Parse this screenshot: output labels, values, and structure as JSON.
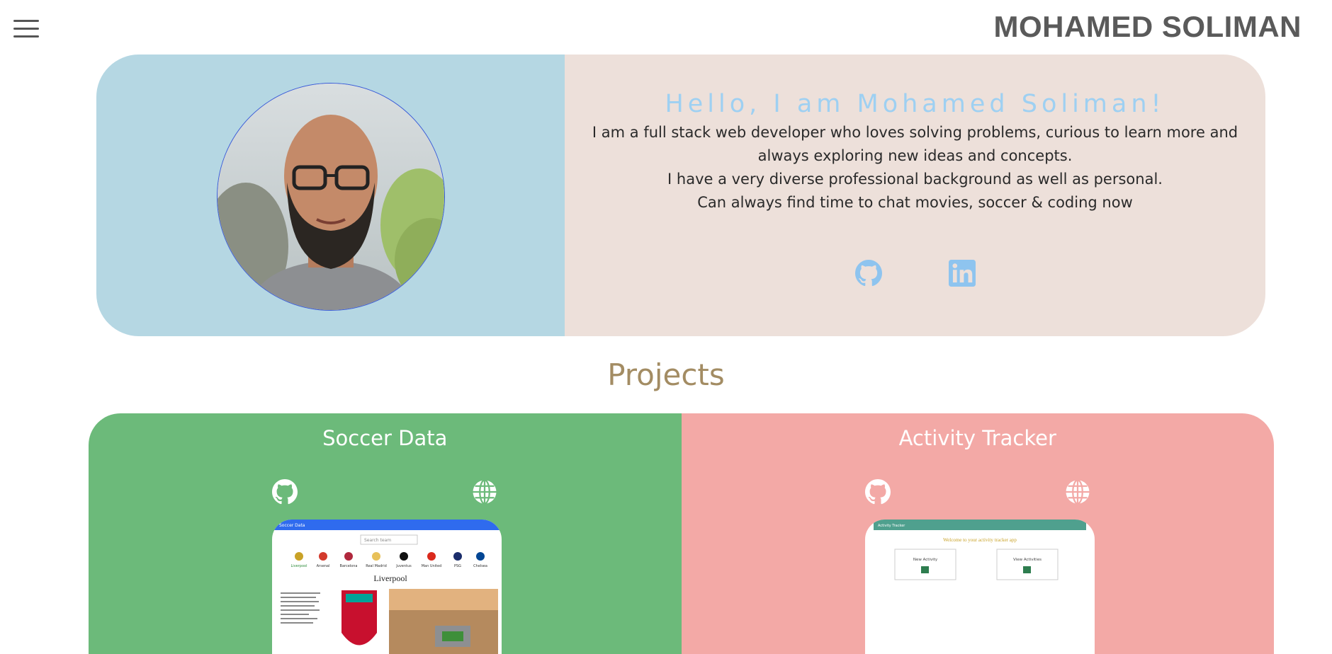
{
  "header": {
    "site_title": "MOHAMED SOLIMAN",
    "menu_icon": "hamburger-menu-icon"
  },
  "hero": {
    "greeting": "Hello, I am Mohamed Soliman!",
    "bio_lines": [
      "I am a full stack web developer who loves solving problems, curious to learn more and always exploring new ideas and concepts.",
      "I have a very diverse professional background as well as personal.",
      "Can always find time to chat movies, soccer & coding now"
    ],
    "links": [
      {
        "icon": "github-icon"
      },
      {
        "icon": "linkedin-icon"
      }
    ]
  },
  "projects": {
    "heading": "Projects",
    "items": [
      {
        "title": "Soccer Data",
        "color": "#6cba7a",
        "links": [
          {
            "icon": "github-icon"
          },
          {
            "icon": "globe-icon"
          }
        ],
        "preview": {
          "app_bar_text": "Soccer Data",
          "search_placeholder": "Search team",
          "teams": [
            "Liverpool",
            "Arsenal",
            "Barcelona",
            "Real Madrid",
            "Juventus",
            "Man United",
            "PSG",
            "Chelsea"
          ],
          "selected_team": "Liverpool"
        }
      },
      {
        "title": "Activity Tracker",
        "color": "#f3a9a6",
        "links": [
          {
            "icon": "github-icon"
          },
          {
            "icon": "globe-icon"
          }
        ],
        "preview": {
          "app_bar_text": "Activity Tracker",
          "welcome": "Welcome to your activity tracker app",
          "cards": [
            "New Activity",
            "View Activities"
          ]
        }
      }
    ]
  },
  "colors": {
    "hero_left_bg": "#b5d7e3",
    "hero_right_bg": "#ede0da",
    "greeting_text": "#9ed0f2",
    "projects_heading": "#a38c63"
  }
}
